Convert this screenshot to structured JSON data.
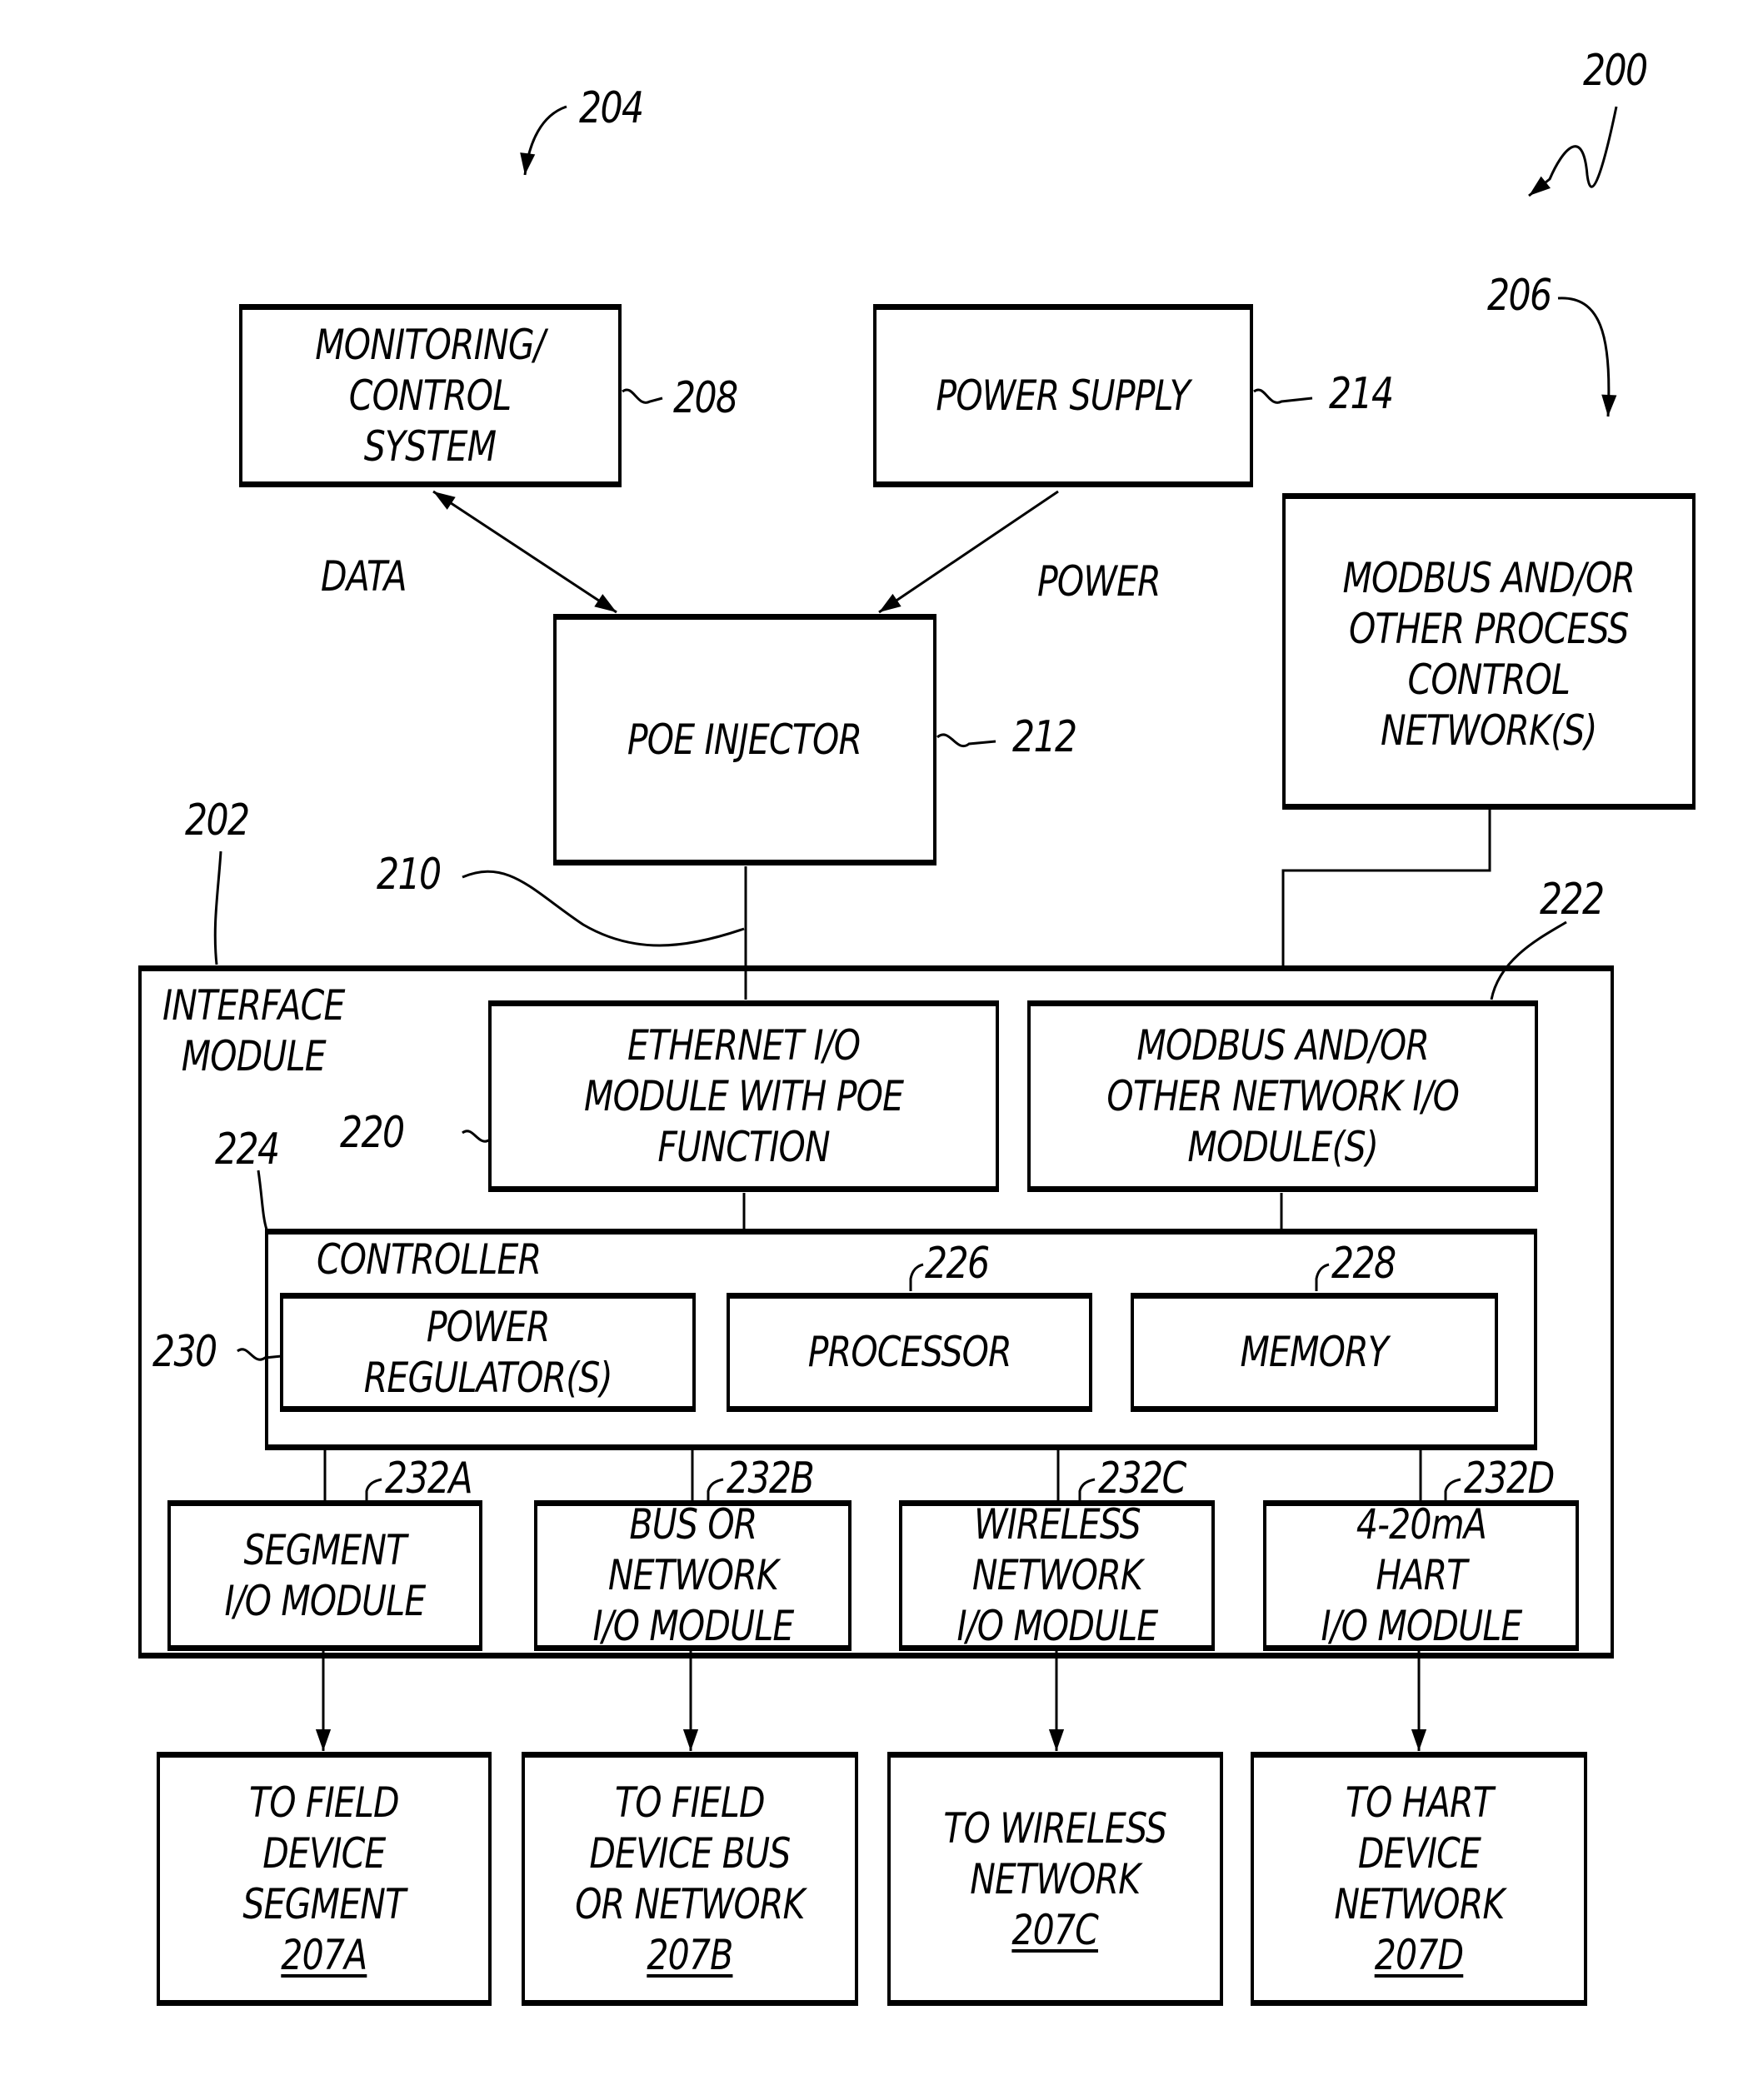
{
  "figure": {
    "figure_ref": "200",
    "refs": {
      "r204": "204",
      "r206": "206",
      "r208": "208",
      "r214": "214",
      "r212": "212",
      "r210": "210",
      "r202": "202",
      "r222": "222",
      "r220": "220",
      "r224": "224",
      "r226": "226",
      "r228": "228",
      "r230": "230",
      "r232a": "232A",
      "r232b": "232B",
      "r232c": "232C",
      "r232d": "232D"
    },
    "flow_labels": {
      "data": "DATA",
      "power": "POWER"
    },
    "boxes": {
      "monitoring": "MONITORING/\nCONTROL\nSYSTEM",
      "power_supply": "POWER SUPPLY",
      "modbus_network": "MODBUS AND/OR\nOTHER PROCESS\nCONTROL\nNETWORK(S)",
      "poe_injector": "POE INJECTOR",
      "interface_module": "INTERFACE\nMODULE",
      "ethernet_io": "ETHERNET I/O\nMODULE WITH POE\nFUNCTION",
      "modbus_io": "MODBUS AND/OR\nOTHER NETWORK I/O\nMODULE(S)",
      "controller": "CONTROLLER",
      "power_regulator": "POWER\nREGULATOR(S)",
      "processor": "PROCESSOR",
      "memory": "MEMORY"
    },
    "io_modules": [
      {
        "label": "SEGMENT\nI/O MODULE"
      },
      {
        "label": "BUS OR\nNETWORK\nI/O MODULE"
      },
      {
        "label": "WIRELESS\nNETWORK\nI/O MODULE"
      },
      {
        "label": "4-20mA\nHART\nI/O MODULE"
      }
    ],
    "destinations": [
      {
        "label": "TO FIELD\nDEVICE\nSEGMENT",
        "ref": "207A"
      },
      {
        "label": "TO FIELD\nDEVICE BUS\nOR NETWORK",
        "ref": "207B"
      },
      {
        "label": "TO WIRELESS\nNETWORK",
        "ref": "207C"
      },
      {
        "label": "TO HART\nDEVICE\nNETWORK",
        "ref": "207D"
      }
    ]
  }
}
